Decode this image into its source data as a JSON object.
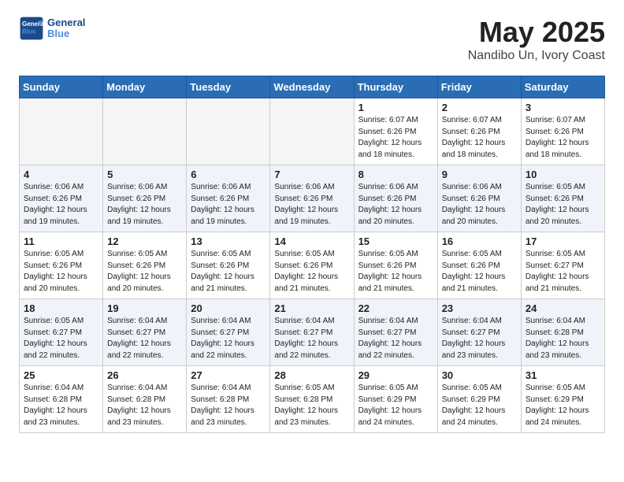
{
  "header": {
    "logo_line1": "General",
    "logo_line2": "Blue",
    "month_title": "May 2025",
    "location": "Nandibo Un, Ivory Coast"
  },
  "weekdays": [
    "Sunday",
    "Monday",
    "Tuesday",
    "Wednesday",
    "Thursday",
    "Friday",
    "Saturday"
  ],
  "weeks": [
    [
      {
        "day": "",
        "info": ""
      },
      {
        "day": "",
        "info": ""
      },
      {
        "day": "",
        "info": ""
      },
      {
        "day": "",
        "info": ""
      },
      {
        "day": "1",
        "info": "Sunrise: 6:07 AM\nSunset: 6:26 PM\nDaylight: 12 hours\nand 18 minutes."
      },
      {
        "day": "2",
        "info": "Sunrise: 6:07 AM\nSunset: 6:26 PM\nDaylight: 12 hours\nand 18 minutes."
      },
      {
        "day": "3",
        "info": "Sunrise: 6:07 AM\nSunset: 6:26 PM\nDaylight: 12 hours\nand 18 minutes."
      }
    ],
    [
      {
        "day": "4",
        "info": "Sunrise: 6:06 AM\nSunset: 6:26 PM\nDaylight: 12 hours\nand 19 minutes."
      },
      {
        "day": "5",
        "info": "Sunrise: 6:06 AM\nSunset: 6:26 PM\nDaylight: 12 hours\nand 19 minutes."
      },
      {
        "day": "6",
        "info": "Sunrise: 6:06 AM\nSunset: 6:26 PM\nDaylight: 12 hours\nand 19 minutes."
      },
      {
        "day": "7",
        "info": "Sunrise: 6:06 AM\nSunset: 6:26 PM\nDaylight: 12 hours\nand 19 minutes."
      },
      {
        "day": "8",
        "info": "Sunrise: 6:06 AM\nSunset: 6:26 PM\nDaylight: 12 hours\nand 20 minutes."
      },
      {
        "day": "9",
        "info": "Sunrise: 6:06 AM\nSunset: 6:26 PM\nDaylight: 12 hours\nand 20 minutes."
      },
      {
        "day": "10",
        "info": "Sunrise: 6:05 AM\nSunset: 6:26 PM\nDaylight: 12 hours\nand 20 minutes."
      }
    ],
    [
      {
        "day": "11",
        "info": "Sunrise: 6:05 AM\nSunset: 6:26 PM\nDaylight: 12 hours\nand 20 minutes."
      },
      {
        "day": "12",
        "info": "Sunrise: 6:05 AM\nSunset: 6:26 PM\nDaylight: 12 hours\nand 20 minutes."
      },
      {
        "day": "13",
        "info": "Sunrise: 6:05 AM\nSunset: 6:26 PM\nDaylight: 12 hours\nand 21 minutes."
      },
      {
        "day": "14",
        "info": "Sunrise: 6:05 AM\nSunset: 6:26 PM\nDaylight: 12 hours\nand 21 minutes."
      },
      {
        "day": "15",
        "info": "Sunrise: 6:05 AM\nSunset: 6:26 PM\nDaylight: 12 hours\nand 21 minutes."
      },
      {
        "day": "16",
        "info": "Sunrise: 6:05 AM\nSunset: 6:26 PM\nDaylight: 12 hours\nand 21 minutes."
      },
      {
        "day": "17",
        "info": "Sunrise: 6:05 AM\nSunset: 6:27 PM\nDaylight: 12 hours\nand 21 minutes."
      }
    ],
    [
      {
        "day": "18",
        "info": "Sunrise: 6:05 AM\nSunset: 6:27 PM\nDaylight: 12 hours\nand 22 minutes."
      },
      {
        "day": "19",
        "info": "Sunrise: 6:04 AM\nSunset: 6:27 PM\nDaylight: 12 hours\nand 22 minutes."
      },
      {
        "day": "20",
        "info": "Sunrise: 6:04 AM\nSunset: 6:27 PM\nDaylight: 12 hours\nand 22 minutes."
      },
      {
        "day": "21",
        "info": "Sunrise: 6:04 AM\nSunset: 6:27 PM\nDaylight: 12 hours\nand 22 minutes."
      },
      {
        "day": "22",
        "info": "Sunrise: 6:04 AM\nSunset: 6:27 PM\nDaylight: 12 hours\nand 22 minutes."
      },
      {
        "day": "23",
        "info": "Sunrise: 6:04 AM\nSunset: 6:27 PM\nDaylight: 12 hours\nand 23 minutes."
      },
      {
        "day": "24",
        "info": "Sunrise: 6:04 AM\nSunset: 6:28 PM\nDaylight: 12 hours\nand 23 minutes."
      }
    ],
    [
      {
        "day": "25",
        "info": "Sunrise: 6:04 AM\nSunset: 6:28 PM\nDaylight: 12 hours\nand 23 minutes."
      },
      {
        "day": "26",
        "info": "Sunrise: 6:04 AM\nSunset: 6:28 PM\nDaylight: 12 hours\nand 23 minutes."
      },
      {
        "day": "27",
        "info": "Sunrise: 6:04 AM\nSunset: 6:28 PM\nDaylight: 12 hours\nand 23 minutes."
      },
      {
        "day": "28",
        "info": "Sunrise: 6:05 AM\nSunset: 6:28 PM\nDaylight: 12 hours\nand 23 minutes."
      },
      {
        "day": "29",
        "info": "Sunrise: 6:05 AM\nSunset: 6:29 PM\nDaylight: 12 hours\nand 24 minutes."
      },
      {
        "day": "30",
        "info": "Sunrise: 6:05 AM\nSunset: 6:29 PM\nDaylight: 12 hours\nand 24 minutes."
      },
      {
        "day": "31",
        "info": "Sunrise: 6:05 AM\nSunset: 6:29 PM\nDaylight: 12 hours\nand 24 minutes."
      }
    ]
  ]
}
